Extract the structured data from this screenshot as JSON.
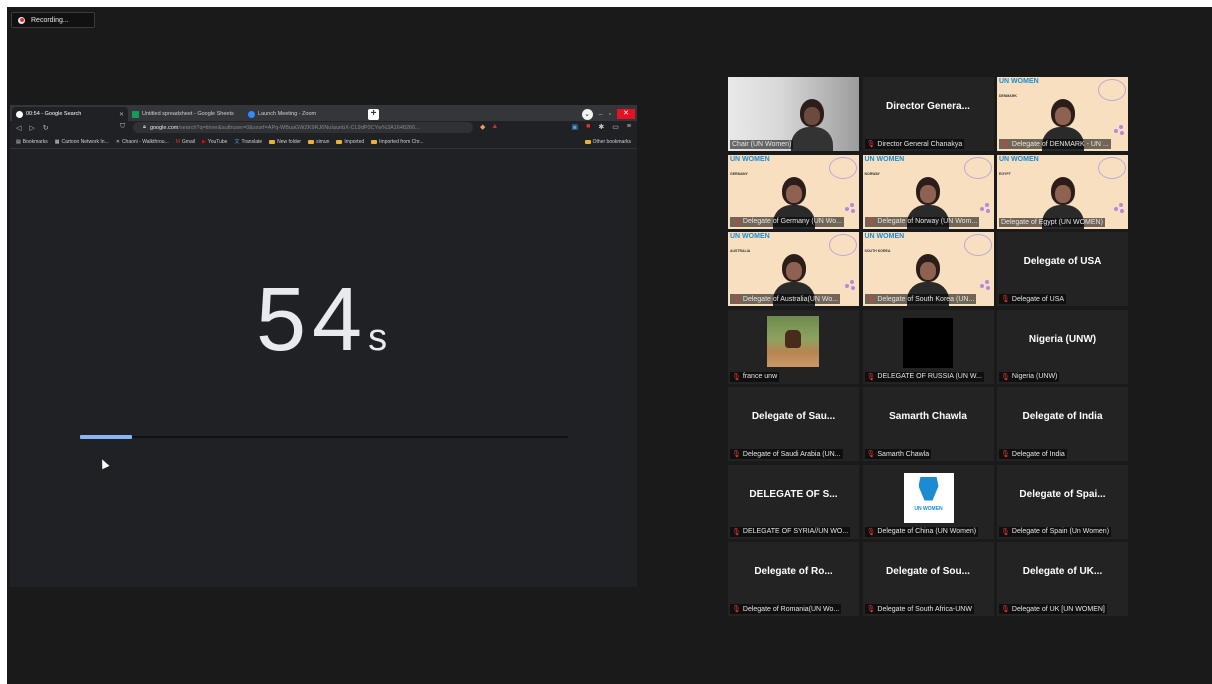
{
  "recording": {
    "label": "Recording..."
  },
  "browser": {
    "tabs": [
      {
        "label": "00:54 - Google Search",
        "icon": "google-icon"
      },
      {
        "label": "Untitled spreadsheet - Google Sheets",
        "icon": "sheets-icon"
      },
      {
        "label": "Launch Meeting - Zoom",
        "icon": "zoom-icon"
      }
    ],
    "address": {
      "host": "google.com",
      "path": "/search?q=timer&authuser=0&sxsrf=APq-WBuaGWZK9RJ6NuIaunbX-CL9dP0CYw%3A1648266..."
    },
    "bookmarks": [
      "Bookmarks",
      "Cartoon Network In...",
      "Chaoni - Walkthrou...",
      "Gmail",
      "YouTube",
      "Translate",
      "New folder",
      "simun",
      "Imported",
      "Imported from Chr..."
    ],
    "other_bookmarks": "Other bookmarks"
  },
  "timer": {
    "value": "54",
    "unit": "s",
    "progress_fraction": 0.107
  },
  "gallery": [
    {
      "name": "Chair (UN Women)",
      "muted": false,
      "type": "video-chair"
    },
    {
      "big": "Director Genera...",
      "name": "Director General Chanakya",
      "muted": true
    },
    {
      "name": "Delegate of DENMARK - UN ...",
      "muted": true,
      "type": "poster",
      "logo": "UN WOMEN",
      "country": "DENMARK"
    },
    {
      "name": "Delegate of Germany (UN Wo...",
      "muted": true,
      "type": "poster",
      "logo": "UN WOMEN",
      "country": "GERMANY"
    },
    {
      "name": "Delegate of Norway (UN Wom...",
      "muted": true,
      "type": "poster",
      "logo": "UN WOMEN",
      "country": "NORWAY"
    },
    {
      "name": "Delegate of Egypt (UN WOMEN)",
      "muted": false,
      "type": "poster",
      "logo": "UN WOMEN",
      "country": "EGYPT",
      "speaking": true
    },
    {
      "name": "Delegate of Australia(UN Wo...",
      "muted": true,
      "type": "poster",
      "logo": "UN WOMEN",
      "country": "AUSTRALIA"
    },
    {
      "name": "Delegate of South Korea (UN...",
      "muted": true,
      "type": "poster",
      "logo": "UN WOMEN",
      "country": "SOUTH KOREA"
    },
    {
      "big": "Delegate of USA",
      "name": "Delegate of USA",
      "muted": true
    },
    {
      "name": "france unw",
      "muted": true,
      "type": "horse"
    },
    {
      "name": "DELEGATE OF RUSSIA (UN W...",
      "muted": true,
      "type": "black"
    },
    {
      "big": "Nigeria (UNW)",
      "name": "Nigeria (UNW)",
      "muted": true
    },
    {
      "big": "Delegate of Sau...",
      "name": "Delegate of Saudi Arabia (UN...",
      "muted": true
    },
    {
      "big": "Samarth Chawla",
      "name": "Samarth Chawla",
      "muted": true
    },
    {
      "big": "Delegate of India",
      "name": "Delegate of India",
      "muted": true
    },
    {
      "big": "DELEGATE OF S...",
      "name": "DELEGATE OF SYRIA//UN WO...",
      "muted": true
    },
    {
      "name": "Delegate of China (UN Women)",
      "muted": true,
      "type": "unwlogo",
      "logo": "UN WOMEN"
    },
    {
      "big": "Delegate of Spai...",
      "name": "Delegate of Spain (Un Women)",
      "muted": true
    },
    {
      "big": "Delegate of Ro...",
      "name": "Delegate of Romania(UN Wo...",
      "muted": true
    },
    {
      "big": "Delegate of Sou...",
      "name": "Delegate of South Africa-UNW",
      "muted": true
    },
    {
      "big": "Delegate of UK...",
      "name": "Delegate of UK [UN WOMEN]",
      "muted": true
    }
  ]
}
